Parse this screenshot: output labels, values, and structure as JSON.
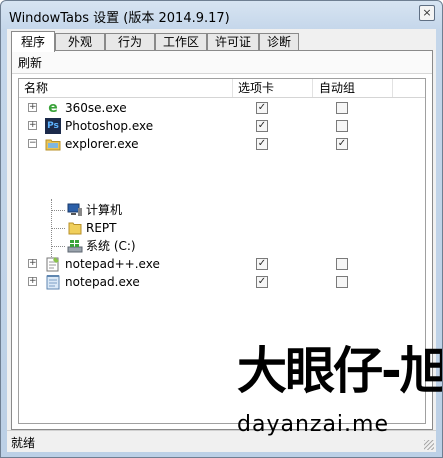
{
  "window": {
    "title": "WindowTabs 设置 (版本 2014.9.17)",
    "close_glyph": "×"
  },
  "tabs": [
    {
      "label": "程序",
      "active": true
    },
    {
      "label": "外观",
      "active": false
    },
    {
      "label": "行为",
      "active": false
    },
    {
      "label": "工作区",
      "active": false
    },
    {
      "label": "许可证",
      "active": false
    },
    {
      "label": "诊断",
      "active": false
    }
  ],
  "toolbar": {
    "refresh_label": "刷新"
  },
  "list": {
    "columns": [
      "名称",
      "选项卡",
      "自动组"
    ],
    "rows": [
      {
        "name": "360se.exe",
        "icon": "browser-360se-icon",
        "expander": "+",
        "tabs_checked": true,
        "autogroup_checked": false
      },
      {
        "name": "Photoshop.exe",
        "icon": "photoshop-icon",
        "expander": "+",
        "tabs_checked": true,
        "autogroup_checked": false
      },
      {
        "name": "explorer.exe",
        "icon": "folder-icon",
        "expander": "−",
        "tabs_checked": true,
        "autogroup_checked": true
      },
      {
        "name": "计算机",
        "icon": "computer-icon",
        "child": true
      },
      {
        "name": "REPT",
        "icon": "folder-icon",
        "child": true
      },
      {
        "name": "系统 (C:)",
        "icon": "drive-icon",
        "child": true
      },
      {
        "name": "notepad++.exe",
        "icon": "notepadpp-icon",
        "expander": "+",
        "tabs_checked": true,
        "autogroup_checked": false
      },
      {
        "name": "notepad.exe",
        "icon": "notepad-icon",
        "expander": "+",
        "tabs_checked": true,
        "autogroup_checked": false
      }
    ]
  },
  "status": {
    "text": "就绪"
  },
  "watermark": {
    "big": "大眼仔-旭",
    "small": "dayanzai.me"
  },
  "colors": {
    "title_bg": "#c4d6ea",
    "photoshop_bg": "#1b2a4a",
    "photoshop_fg": "#5fb4ff",
    "folder": "#e9c456",
    "ie_green": "#3aa23a"
  }
}
